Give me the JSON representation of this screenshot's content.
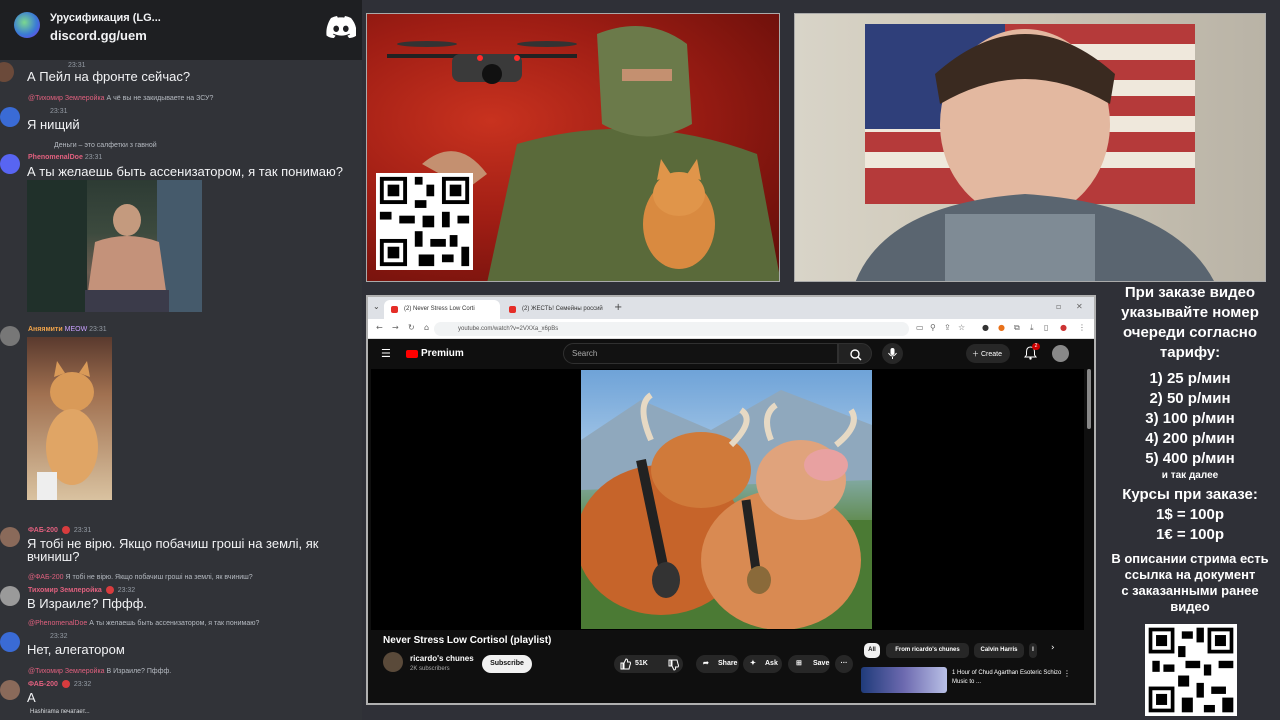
{
  "discord": {
    "server_name": "Урусификация (LG...",
    "server_invite": "discord.gg/uem",
    "typing_indicator": "Hashirama печатает...",
    "messages": [
      {
        "time": "23:31",
        "text": "А Пейл на фронте сейчас?"
      },
      {
        "reply_author": "@Тихомир Землеройка",
        "reply_text": "А чё вы не закидываете на ЗСУ?",
        "time": "23:31",
        "text": "Я нищий"
      },
      {
        "reply_text": "Деньги – это салфетки з гавной",
        "author": "PhenomenalDoe",
        "time": "23:31",
        "text": "А ты желаешь быть ассенизатором, я так понимаю?"
      },
      {
        "author": "Аняямити",
        "role": "MEOW",
        "time": "23:31"
      },
      {
        "author": "ФАБ-200",
        "time": "23:31",
        "text_line1": "Я тобі не вірю. Якщо побачиш гроші на землі, як",
        "text_line2": "вчиниш?"
      },
      {
        "reply_author": "@ФАБ-200",
        "reply_text": "Я тобі не вірю. Якщо побачиш гроші на землі, як вчиниш?",
        "author": "Тихомир Землеройка",
        "time": "23:32",
        "text": "В Израиле? Пффф."
      },
      {
        "reply_author": "@PhenomenalDoe",
        "reply_text": "А ты желаешь быть ассенизатором, я так понимаю?",
        "time": "23:32",
        "text": "Нет, алегатором"
      },
      {
        "reply_author": "@Тихомир Землеройка",
        "reply_text": "В Израиле? Пффф.",
        "author": "ФАБ-200",
        "time": "23:32",
        "text": "А"
      }
    ]
  },
  "browser": {
    "tabs": [
      {
        "label": "(2) Never Stress Low Corti"
      },
      {
        "label": "(2) ЖЕСТЬ! Семейны россий"
      }
    ],
    "new_tab": "+",
    "url": "youtube.com/watch?v=2VXXa_x6pBs"
  },
  "youtube": {
    "logo": "Premium",
    "search_placeholder": "Search",
    "create_label": "Create",
    "notification_count": "2",
    "video_title": "Never Stress Low Cortisol (playlist)",
    "channel_name": "ricardo's chunes",
    "subscribers": "2K subscribers",
    "subscribe_label": "Subscribe",
    "likes": "51K",
    "share_label": "Share",
    "ask_label": "Ask",
    "save_label": "Save",
    "more_label": "···",
    "chips": [
      "All",
      "From ricardo's chunes",
      "Calvin Harris",
      "I"
    ],
    "recommended_title": "1 Hour of Chud Agarthan Esoteric Schizo Music to ..."
  },
  "info_panel": {
    "heading_lines": [
      "При заказе видео",
      "указывайте номер",
      "очереди согласно",
      "тарифу:"
    ],
    "tariffs": [
      "1) 25 р/мин",
      "2) 50 р/мин",
      "3) 100 р/мин",
      "4) 200 р/мин",
      "5) 400 р/мин"
    ],
    "tariffs_more": "и так далее",
    "rates_heading": "Курсы при заказе:",
    "rates": [
      "1$ = 100р",
      "1€ = 100р"
    ],
    "doc_lines": [
      "В описании стрима есть",
      "ссылка на документ",
      "с заказанными ранее",
      "видео"
    ]
  },
  "colors": {
    "discord_bg": "#313338",
    "discord_header": "#1e1f22",
    "youtube_red": "#ff0000",
    "username_pink": "#e0607e",
    "stream_bg": "#2f3037"
  }
}
